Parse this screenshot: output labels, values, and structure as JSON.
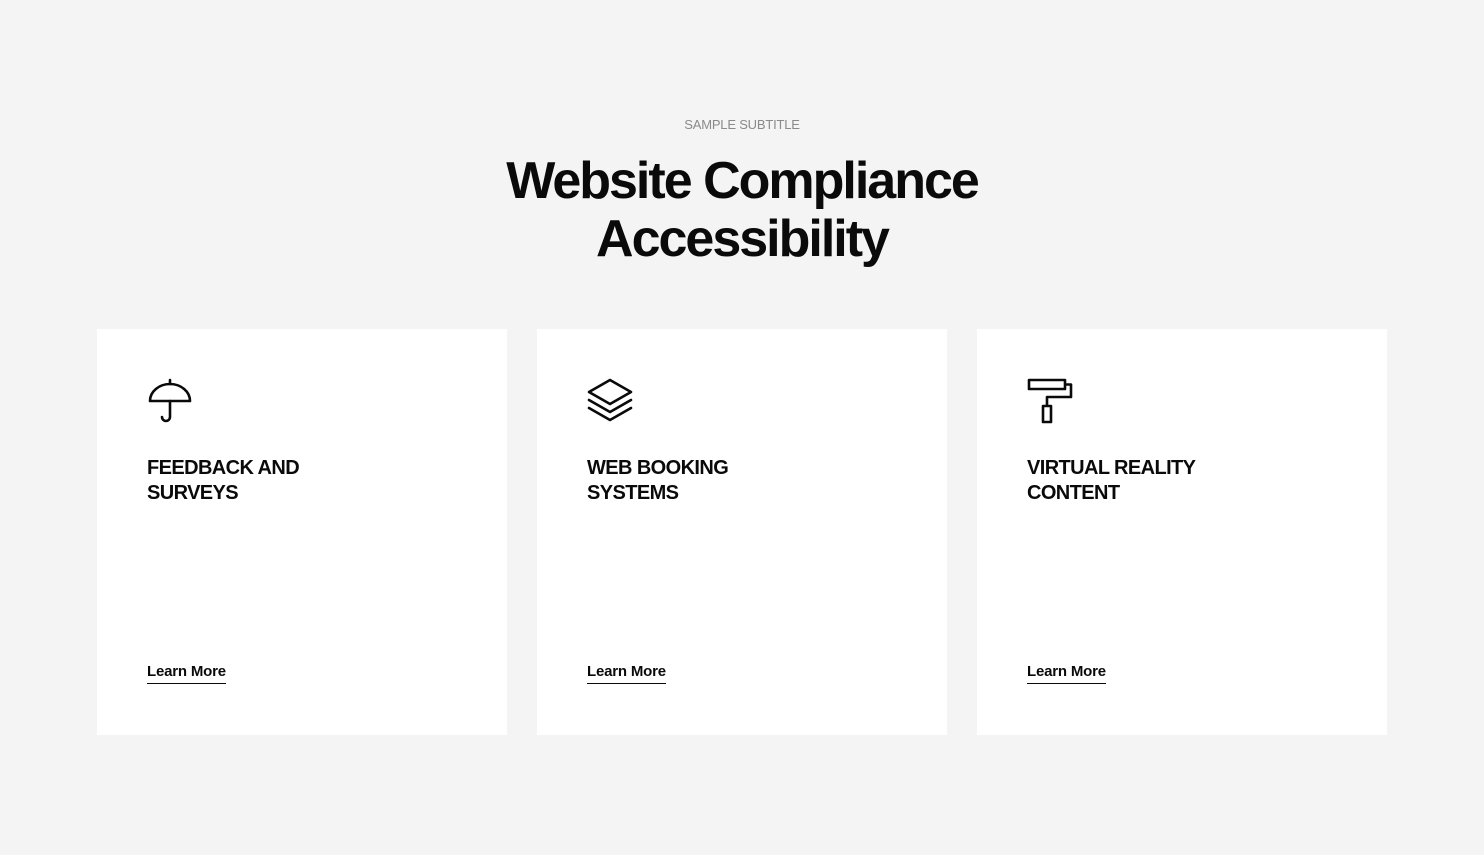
{
  "header": {
    "subtitle": "SAMPLE SUBTITLE",
    "title_line1": "Website Compliance",
    "title_line2": "Accessibility"
  },
  "cards": [
    {
      "icon": "umbrella-icon",
      "title_line1": "FEEDBACK AND",
      "title_line2": "SURVEYS",
      "link_label": "Learn More"
    },
    {
      "icon": "layers-icon",
      "title_line1": "WEB BOOKING",
      "title_line2": "SYSTEMS",
      "link_label": "Learn More"
    },
    {
      "icon": "paint-roller-icon",
      "title_line1": "VIRTUAL REALITY",
      "title_line2": "CONTENT",
      "link_label": "Learn More"
    }
  ],
  "colors": {
    "background": "#f4f4f4",
    "card": "#ffffff",
    "text": "#0a0a0a",
    "subtitle": "#8a8a8a"
  }
}
